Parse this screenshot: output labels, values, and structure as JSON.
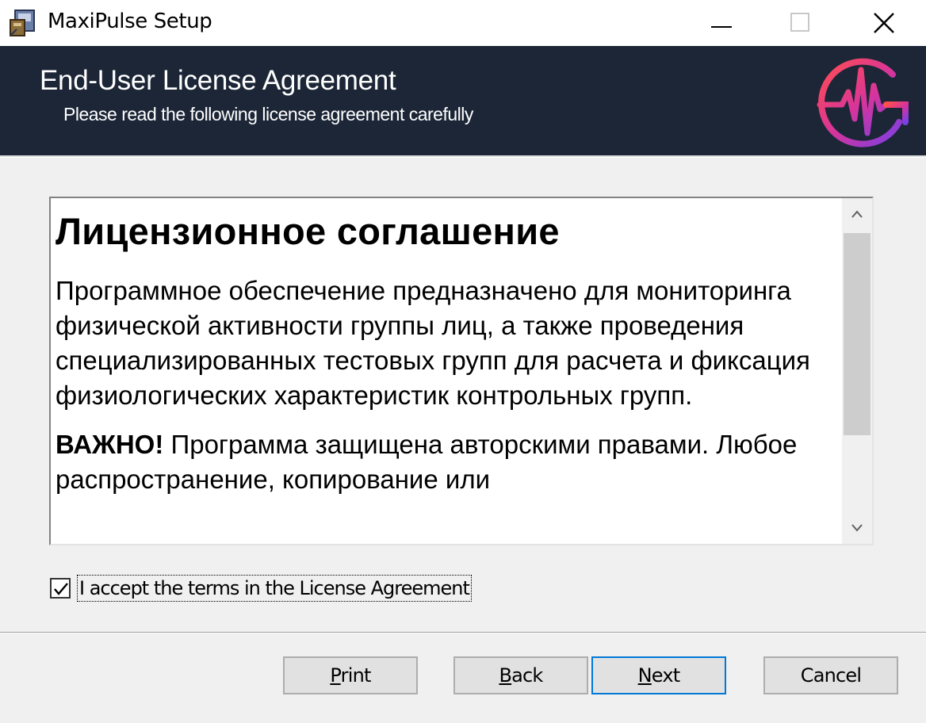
{
  "window": {
    "title": "MaxiPulse Setup",
    "controls": [
      "minimize-icon",
      "maximize-icon",
      "close-icon"
    ]
  },
  "banner": {
    "title": "End-User License Agreement",
    "subtitle": "Please read the following license agreement carefully",
    "logo_icon": "heartbeat-logo-icon"
  },
  "license": {
    "heading": "Лицензионное соглашение",
    "paragraph1": "Программное обеспечение предназначено для мониторинга физической активности группы лиц, а также проведения специализированных тестовых групп для расчета и фиксация физиологических характеристик контрольных групп.",
    "paragraph2_bold": "ВАЖНО!",
    "paragraph2": " Программа защищена авторскими правами. Любое распространение, копирование или"
  },
  "accept": {
    "label": "I accept the terms in the License Agreement",
    "checked": true
  },
  "buttons": {
    "print": {
      "mnemonic": "P",
      "rest": "rint"
    },
    "back": {
      "mnemonic": "B",
      "rest": "ack"
    },
    "next": {
      "mnemonic": "N",
      "rest": "ext"
    },
    "cancel": {
      "label": "Cancel"
    }
  },
  "colors": {
    "banner_bg": "#1c2637",
    "default_button_border": "#0078d7",
    "logo_gradient": [
      "#ff4e50",
      "#c62aa3",
      "#7b3fe4"
    ]
  }
}
